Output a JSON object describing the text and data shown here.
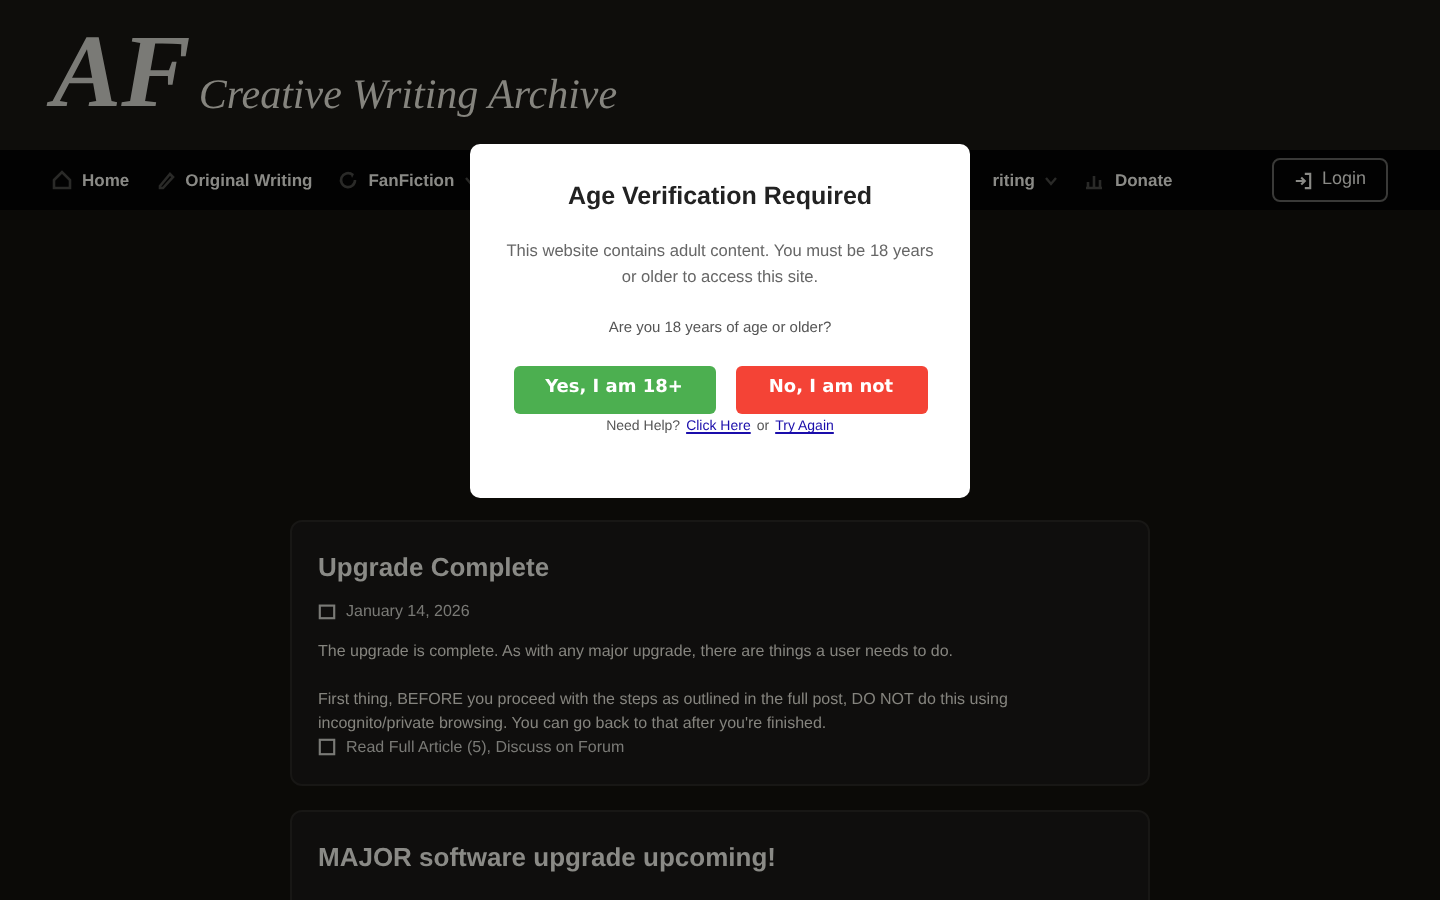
{
  "header": {
    "logo_mark": "AF",
    "site_name": "Creative Writing Archive"
  },
  "nav": {
    "items": [
      {
        "label": "Home",
        "kind": "link"
      },
      {
        "label": "Original Writing",
        "kind": "link"
      },
      {
        "label": "FanFiction",
        "kind": "dropdown"
      }
    ],
    "right_items": [
      {
        "label": "riting",
        "kind": "dropdown"
      },
      {
        "label": "Donate",
        "kind": "link"
      }
    ],
    "login": "Login"
  },
  "posts": [
    {
      "title": "Upgrade Complete",
      "date": "January 14, 2026",
      "paragraphs": [
        "The upgrade is complete. As with any major upgrade, there are things a user needs to do.",
        "First thing, BEFORE you proceed with the steps as outlined in the full post, DO NOT do this using incognito/private browsing. You can go back to that after you're finished."
      ],
      "links": "Read Full Article (5), Discuss on Forum"
    },
    {
      "title": "MAJOR software upgrade upcoming!"
    }
  ],
  "modal": {
    "title": "Age Verification Required",
    "message": "This website contains adult content. You must be 18 years or older to access this site.",
    "question": "Are you 18 years of age or older?",
    "buttons": [
      {
        "label": "Yes, I am 18+",
        "kind": "confirm"
      },
      {
        "label": "No, I am not",
        "kind": "deny"
      }
    ],
    "help_prefix": "Need Help?",
    "help_link_1": "Click Here",
    "help_middle": "or",
    "help_link_2": "Try Again"
  }
}
